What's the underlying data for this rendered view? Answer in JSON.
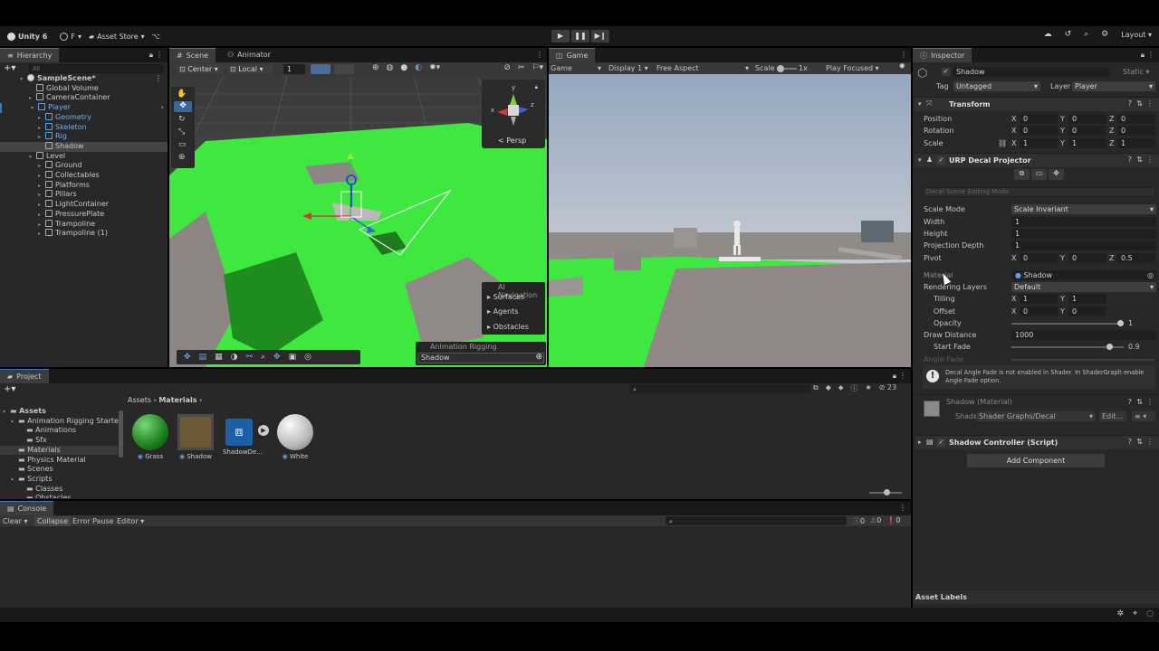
{
  "toolbar": {
    "unity_label": "Unity 6",
    "account_label": "F",
    "asset_store_label": "Asset Store",
    "layout_label": "Layout"
  },
  "hierarchy": {
    "tab": "Hierarchy",
    "search_placeholder": "All",
    "items": [
      "SampleScene*",
      "Global Volume",
      "CameraContainer",
      "Player",
      "Geometry",
      "Skeleton",
      "Rig",
      "Shadow",
      "Level",
      "Ground",
      "Collectables",
      "Platforms",
      "Pillars",
      "LightContainer",
      "PressurePlate",
      "Trampoline",
      "Trampoline (1)"
    ]
  },
  "scene": {
    "tabs": [
      "Scene",
      "Animator"
    ],
    "pivot_label": "Center",
    "space_label": "Local",
    "grid_value": "1",
    "persp_label": "< Persp",
    "gizmo_axis_y": "y",
    "gizmo_axis_x": "x",
    "gizmo_axis_z": "z",
    "ai_nav_title": "AI Navigation",
    "ai_nav_items": [
      "Surfaces",
      "Agents",
      "Obstacles"
    ],
    "rig_title": "Animation Rigging",
    "rig_value": "Shadow"
  },
  "game": {
    "tab": "Game",
    "mode": "Game",
    "display": "Display 1",
    "aspect": "Free Aspect",
    "scale_label": "Scale",
    "scale_value": "1x",
    "play_focus": "Play Focused"
  },
  "inspector": {
    "tab": "Inspector",
    "object_name": "Shadow",
    "static_label": "Static",
    "tag_label": "Tag",
    "tag_value": "Untagged",
    "layer_label": "Layer",
    "layer_value": "Player",
    "transform": {
      "title": "Transform",
      "position_label": "Position",
      "position": [
        "0",
        "0",
        "0"
      ],
      "rotation_label": "Rotation",
      "rotation": [
        "0",
        "0",
        "0"
      ],
      "scale_label": "Scale",
      "scale": [
        "1",
        "1",
        "1"
      ]
    },
    "decal": {
      "title": "URP Decal Projector",
      "editing_mode": "Decal Scene Editing Mode",
      "scale_mode_label": "Scale Mode",
      "scale_mode": "Scale Invariant",
      "width_label": "Width",
      "width": "1",
      "height_label": "Height",
      "height": "1",
      "depth_label": "Projection Depth",
      "depth": "1",
      "pivot_label": "Pivot",
      "pivot": [
        "0",
        "0",
        "0.5"
      ],
      "material_label": "Material",
      "material": "Shadow",
      "layers_label": "Rendering Layers",
      "layers": "Default",
      "tiling_label": "Tilling",
      "tiling": [
        "1",
        "1"
      ],
      "offset_label": "Offset",
      "offset": [
        "0",
        "0"
      ],
      "opacity_label": "Opacity",
      "opacity": "1",
      "draw_label": "Draw Distance",
      "draw": "1000",
      "fade_label": "Start Fade",
      "fade": "0.9",
      "angle_label": "Angle Fade",
      "warning": "Decal Angle Fade is not enabled in Shader. In ShaderGraph enable Angle Fade option."
    },
    "material": {
      "title": "Shadow (Material)",
      "shader_label": "Shader",
      "shader_value": "Shader Graphs/Decal",
      "edit_label": "Edit..."
    },
    "script_title": "Shadow Controller (Script)",
    "add_component": "Add Component",
    "asset_labels": "Asset Labels"
  },
  "project": {
    "tab": "Project",
    "tree": [
      "Assets",
      "Animation Rigging Starter",
      "Animations",
      "Sfx",
      "Materials",
      "Physics Material",
      "Scenes",
      "Scripts",
      "Classes",
      "Obstacles"
    ],
    "breadcrumb_root": "Assets",
    "breadcrumb_leaf": "Materials",
    "count": "23",
    "assets": [
      "Grass",
      "Shadow",
      "ShadowDe...",
      "White"
    ]
  },
  "console": {
    "tab": "Console",
    "clear": "Clear",
    "collapse": "Collapse",
    "error_pause": "Error Pause",
    "editor": "Editor",
    "counts": [
      "0",
      "0",
      "0"
    ]
  },
  "colors": {
    "accent": "#3a79bb",
    "grass": "#3ee83e",
    "panel": "#282828"
  }
}
